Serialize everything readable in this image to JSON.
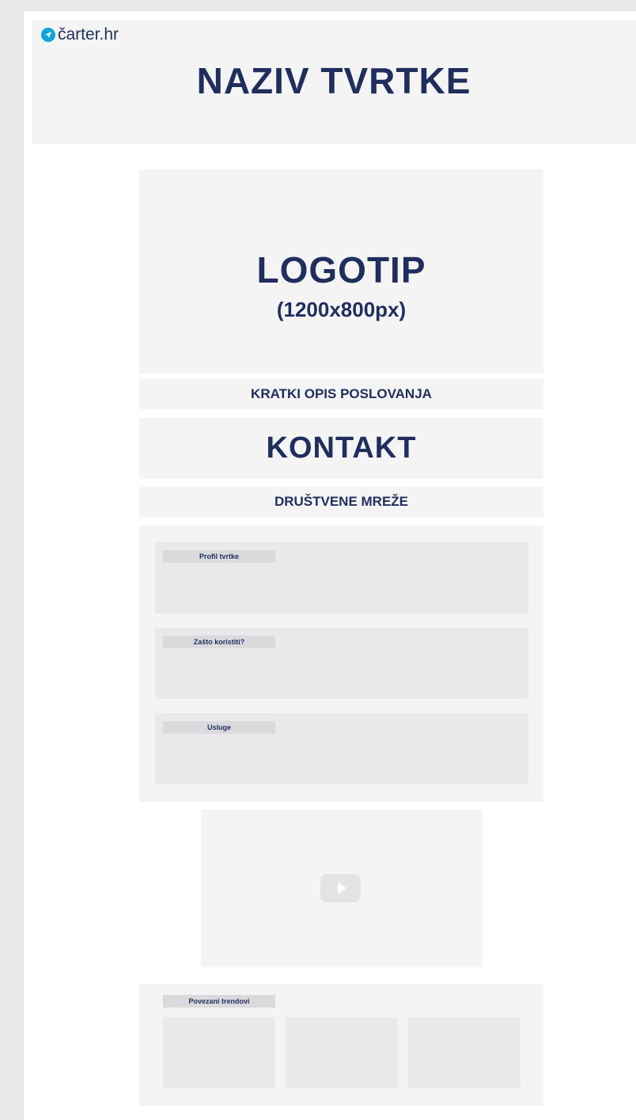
{
  "brand": {
    "name": "čarter.hr",
    "icon": "paper-plane-icon",
    "accent": "#0ea5d6"
  },
  "header": {
    "title": "NAZIV TVRTKE"
  },
  "logo": {
    "title": "LOGOTIP",
    "size": "(1200x800px)"
  },
  "description": {
    "label": "KRATKI OPIS POSLOVANJA"
  },
  "contact": {
    "label": "KONTAKT"
  },
  "social": {
    "label": "DRUŠTVENE MREŽE"
  },
  "sections": [
    {
      "label": "Profil tvrtke"
    },
    {
      "label": "Zašto koristiti?"
    },
    {
      "label": "Usluge"
    }
  ],
  "video": {
    "icon": "play-icon"
  },
  "trends": {
    "label": "Povezani trendovi",
    "cards": 3
  },
  "colors": {
    "text": "#1f2e5c",
    "panel": "#f4f4f5",
    "inner": "#e9e9eb"
  }
}
